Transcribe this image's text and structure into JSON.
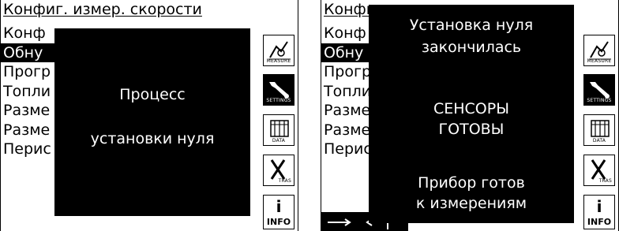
{
  "menu": {
    "title": "Конфиг. измер. скорости",
    "items": [
      "Конф",
      "Обну",
      "Прогр",
      "Топли",
      "Разме",
      "Разме",
      "Перис"
    ],
    "selected_index": 1
  },
  "buttons": [
    {
      "label": "MEASURE",
      "icon": "measure-icon"
    },
    {
      "label": "SETTINGS",
      "icon": "wrench-icon"
    },
    {
      "label": "DATA",
      "icon": "data-books-icon"
    },
    {
      "label": "TRAS",
      "icon": "x-tras-icon"
    },
    {
      "label": "INFO",
      "icon": "info-icon",
      "letter": "i"
    }
  ],
  "left_dialog": {
    "line1": "Процесс",
    "line2": "установки нуля"
  },
  "right_dialog": {
    "line1": "Установка нуля",
    "line2": "закончилась",
    "line3": "СЕНСОРЫ",
    "line4": "ГОТОВЫ",
    "line5": "Прибор готов",
    "line6": "к измерениям"
  },
  "colors": {
    "foreground": "#000000",
    "background": "#ffffff"
  }
}
